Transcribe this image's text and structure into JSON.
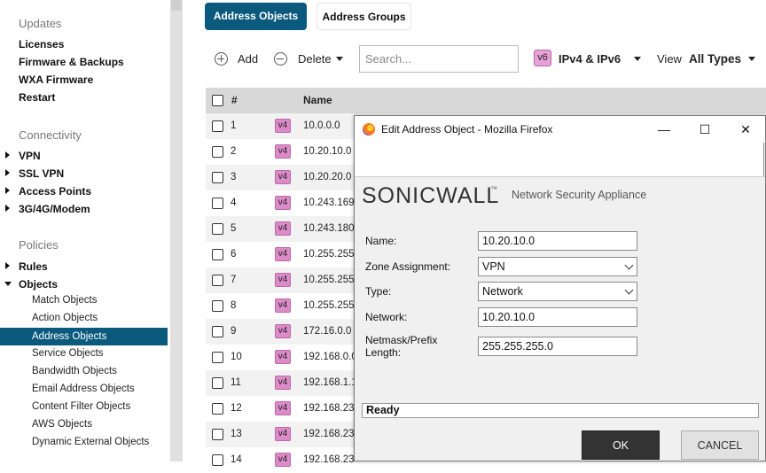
{
  "sidebar": {
    "updates_title": "Updates",
    "updates_items": [
      "Licenses",
      "Firmware & Backups",
      "WXA Firmware",
      "Restart"
    ],
    "connectivity_title": "Connectivity",
    "connectivity_items": [
      "VPN",
      "SSL VPN",
      "Access Points",
      "3G/4G/Modem"
    ],
    "policies_title": "Policies",
    "policies_items": [
      "Rules",
      "Objects"
    ],
    "objects_sub": [
      "Match Objects",
      "Action Objects",
      "Address Objects",
      "Service Objects",
      "Bandwidth Objects",
      "Email Address Objects",
      "Content Filter Objects",
      "AWS Objects",
      "Dynamic External Objects"
    ],
    "selected": "Address Objects"
  },
  "tabs": [
    "Address Objects",
    "Address Groups"
  ],
  "toolbar": {
    "add_label": "Add",
    "delete_label": "Delete",
    "search_placeholder": "Search...",
    "ip_badge": "v6",
    "ip_version_label": "IPv4 & IPv6",
    "view_label": "View",
    "view_value": "All Types"
  },
  "table": {
    "headers": [
      "#",
      "Name"
    ],
    "rows": [
      {
        "num": "1",
        "ver": "v4",
        "name": "10.0.0.0"
      },
      {
        "num": "2",
        "ver": "v4",
        "name": "10.20.10.0"
      },
      {
        "num": "3",
        "ver": "v4",
        "name": "10.20.20.0"
      },
      {
        "num": "4",
        "ver": "v4",
        "name": "10.243.169."
      },
      {
        "num": "5",
        "ver": "v4",
        "name": "10.243.180."
      },
      {
        "num": "6",
        "ver": "v4",
        "name": "10.255.255."
      },
      {
        "num": "7",
        "ver": "v4",
        "name": "10.255.255."
      },
      {
        "num": "8",
        "ver": "v4",
        "name": "10.255.255."
      },
      {
        "num": "9",
        "ver": "v4",
        "name": "172.16.0.0"
      },
      {
        "num": "10",
        "ver": "v4",
        "name": "192.168.0.0"
      },
      {
        "num": "11",
        "ver": "v4",
        "name": "192.168.1.1"
      },
      {
        "num": "12",
        "ver": "v4",
        "name": "192.168.23"
      },
      {
        "num": "13",
        "ver": "v4",
        "name": "192.168.23"
      },
      {
        "num": "14",
        "ver": "v4",
        "name": "192.168.23"
      }
    ]
  },
  "dialog": {
    "title": "Edit Address Object - Mozilla Firefox",
    "logo_text": "SONICWALL",
    "logo_tm": "™",
    "logo_subtitle": "Network Security Appliance",
    "fields": {
      "name_label": "Name:",
      "name_value": "10.20.10.0",
      "zone_label": "Zone Assignment:",
      "zone_value": "VPN",
      "type_label": "Type:",
      "type_value": "Network",
      "network_label": "Network:",
      "network_value": "10.20.10.0",
      "netmask_label_1": "Netmask/Prefix",
      "netmask_label_2": "Length:",
      "netmask_value": "255.255.255.0"
    },
    "status": "Ready",
    "ok_label": "OK",
    "cancel_label": "CANCEL",
    "minimize_glyph": "—",
    "maximize_glyph": "☐",
    "close_glyph": "✕"
  },
  "colors": {
    "accent": "#0b5a7e",
    "badge_pink": "#dd8ac9",
    "ok_button": "#333333"
  }
}
